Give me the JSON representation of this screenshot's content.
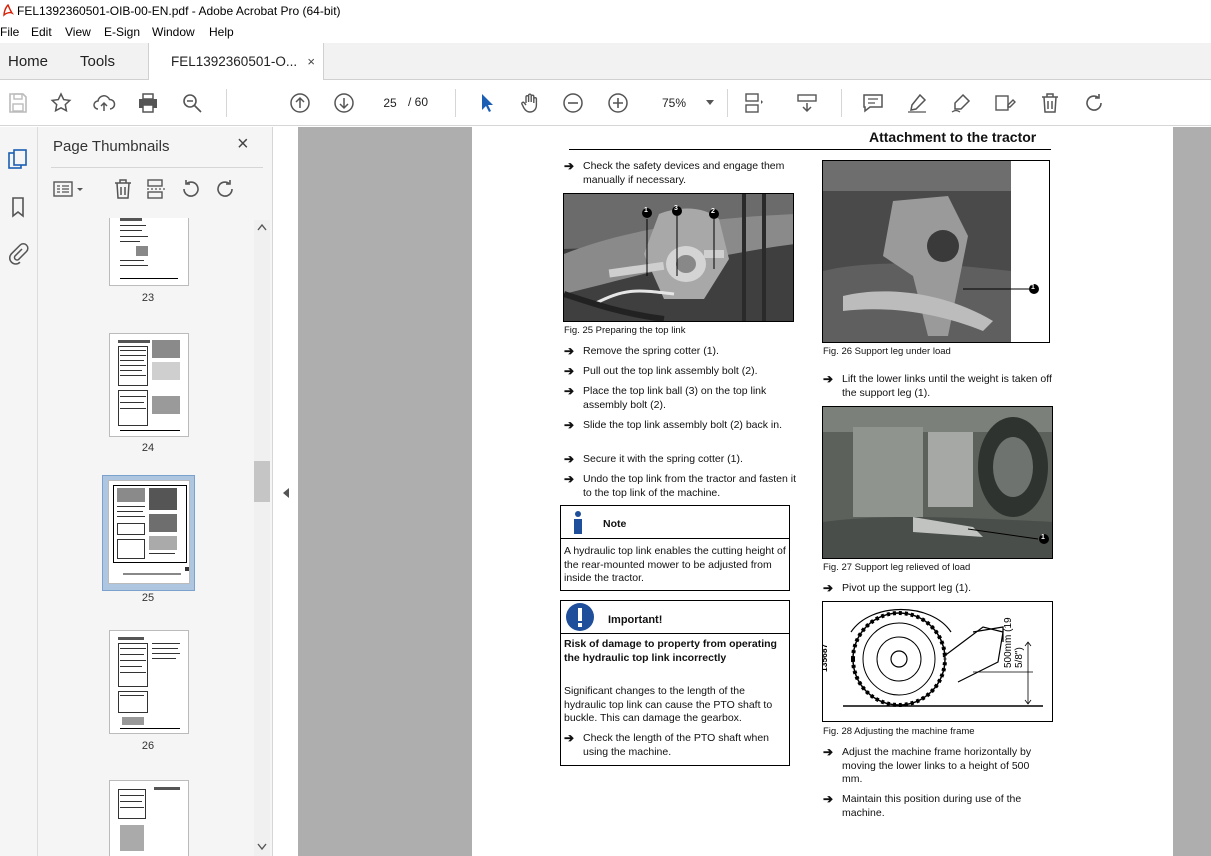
{
  "window": {
    "title": "FEL1392360501-OIB-00-EN.pdf - Adobe Acrobat Pro (64-bit)"
  },
  "menu": [
    "File",
    "Edit",
    "View",
    "E-Sign",
    "Window",
    "Help"
  ],
  "tabs": {
    "home": "Home",
    "tools": "Tools",
    "doc": "FEL1392360501-O...",
    "close": "×"
  },
  "toolbar": {
    "page_current": "25",
    "page_total": "/ 60",
    "zoom": "75%"
  },
  "thumbnails": {
    "title": "Page Thumbnails",
    "close": "×",
    "pages": [
      "23",
      "24",
      "25",
      "26"
    ]
  },
  "document": {
    "header": "Attachment to the tractor",
    "left_col": {
      "step_check": "Check the safety devices and engage them manually if necessary.",
      "fig25_caption": "Fig. 25    Preparing the top link",
      "fig25_labels": [
        "1",
        "3",
        "2"
      ],
      "steps": [
        "Remove the spring cotter (1).",
        "Pull out the top link assembly bolt (2).",
        "Place the top link ball (3) on the top link assembly bolt (2).",
        "Slide the top link assembly bolt (2) back in.",
        "Secure it with the spring cotter (1).",
        "Undo the top link from the tractor and fasten it to the top link of the machine."
      ],
      "note": {
        "title": "Note",
        "text": "A hydraulic top link enables the cutting height of the rear-mounted mower to be adjusted from inside the tractor."
      },
      "important": {
        "title": "Important!",
        "heading": "Risk of damage to property from operating the hydraulic top link incorrectly",
        "text": "Significant changes to the length of the hydraulic top link can cause the PTO shaft to buckle. This can damage the gearbox.",
        "step": "Check the length of the PTO shaft when using the machine."
      }
    },
    "right_col": {
      "fig26_caption": "Fig. 26    Support leg under load",
      "fig26_label": "1",
      "step_lift": "Lift the lower links until the weight is taken off the support leg (1).",
      "fig27_caption": "Fig. 27    Support leg relieved of load",
      "fig27_label": "1",
      "step_pivot": "Pivot up the support leg (1).",
      "fig28_caption": "Fig. 28    Adjusting the machine frame",
      "fig28_code": "135687",
      "fig28_dim": "500mm (19 5/8\")",
      "step_adjust": "Adjust the machine frame horizontally by moving the lower links to a height of 500 mm.",
      "step_maintain": "Maintain this position during use of the machine."
    }
  }
}
